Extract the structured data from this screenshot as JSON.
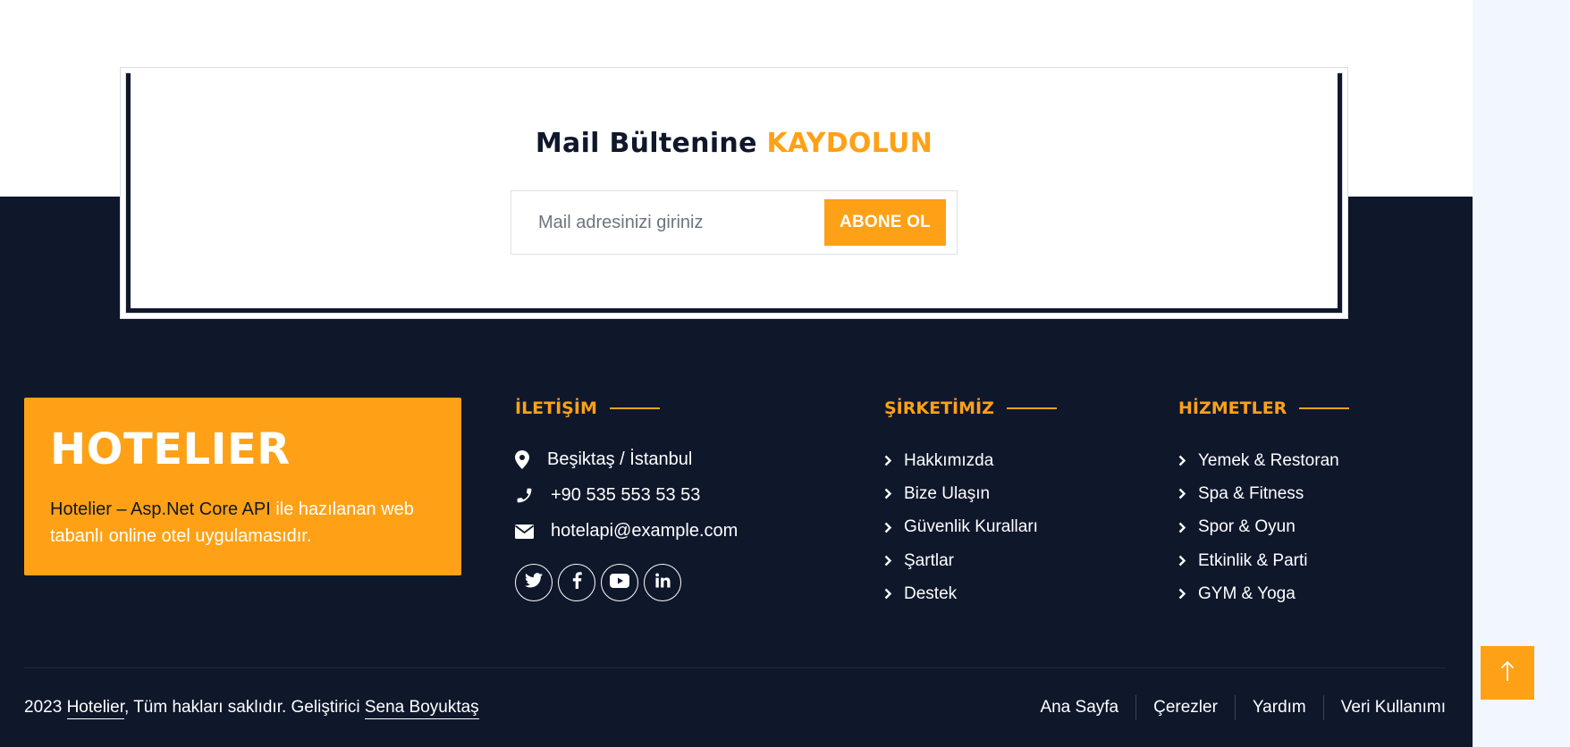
{
  "newsletter": {
    "title_prefix": "Mail Bültenine",
    "title_accent": "KAYDOLUN",
    "email_placeholder": "Mail adresinizi giriniz",
    "subscribe_label": "ABONE OL"
  },
  "brand": {
    "name": "HOTELIER",
    "desc_link": "Hotelier – Asp.Net Core API",
    "desc_rest": " ile hazılanan web tabanlı online otel uygulamasıdır."
  },
  "contact": {
    "heading": "İLETİŞİM",
    "location": "Beşiktaş / İstanbul",
    "phone": "+90 535 553 53 53",
    "email": "hotelapi@example.com",
    "socials": [
      "twitter-icon",
      "facebook-icon",
      "youtube-icon",
      "linkedin-icon"
    ]
  },
  "company": {
    "heading": "ŞİRKETİMİZ",
    "items": [
      "Hakkımızda",
      "Bize Ulaşın",
      "Güvenlik Kuralları",
      "Şartlar",
      "Destek"
    ]
  },
  "services": {
    "heading": "HİZMETLER",
    "items": [
      "Yemek & Restoran",
      "Spa & Fitness",
      "Spor & Oyun",
      "Etkinlik & Parti",
      "GYM & Yoga"
    ]
  },
  "footer": {
    "year": "2023",
    "brand_link": "Hotelier",
    "rights": ", Tüm hakları saklıdır. Geliştirici",
    "developer_link": "Sena Boyuktaş",
    "menu": [
      "Ana Sayfa",
      "Çerezler",
      "Yardım",
      "Veri Kullanımı"
    ]
  },
  "colors": {
    "accent": "#fea116",
    "dark": "#0f172b"
  }
}
